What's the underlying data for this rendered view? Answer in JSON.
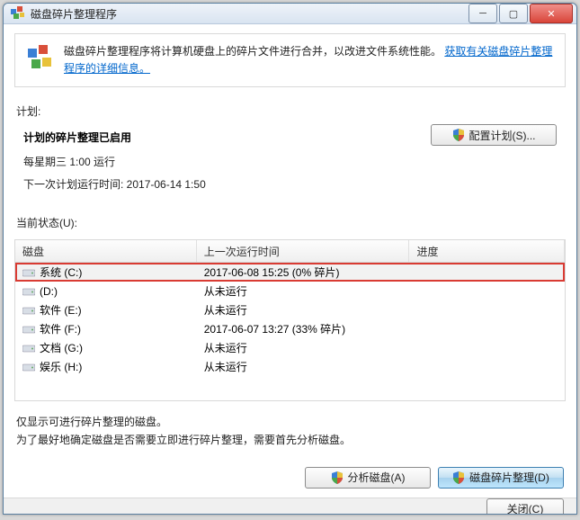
{
  "window": {
    "title": "磁盘碎片整理程序"
  },
  "info": {
    "text_prefix": "磁盘碎片整理程序将计算机硬盘上的碎片文件进行合并，以改进文件系统性能。",
    "link_text": "获取有关磁盘碎片整理程序的详细信息。"
  },
  "schedule": {
    "section_label": "计划:",
    "heading": "计划的碎片整理已启用",
    "frequency": "每星期三  1:00 运行",
    "next_run": "下一次计划运行时间: 2017-06-14 1:50",
    "configure_btn": "配置计划(S)..."
  },
  "status": {
    "section_label": "当前状态(U):",
    "columns": {
      "disk": "磁盘",
      "last_run": "上一次运行时间",
      "progress": "进度"
    },
    "rows": [
      {
        "name": "系统 (C:)",
        "last_run": "2017-06-08 15:25 (0% 碎片)",
        "progress": "",
        "selected": true
      },
      {
        "name": "(D:)",
        "last_run": "从未运行",
        "progress": "",
        "selected": false
      },
      {
        "name": "软件 (E:)",
        "last_run": "从未运行",
        "progress": "",
        "selected": false
      },
      {
        "name": "软件 (F:)",
        "last_run": "2017-06-07 13:27 (33% 碎片)",
        "progress": "",
        "selected": false
      },
      {
        "name": "文档 (G:)",
        "last_run": "从未运行",
        "progress": "",
        "selected": false
      },
      {
        "name": "娱乐 (H:)",
        "last_run": "从未运行",
        "progress": "",
        "selected": false
      }
    ]
  },
  "hint": {
    "line1": "仅显示可进行碎片整理的磁盘。",
    "line2": "为了最好地确定磁盘是否需要立即进行碎片整理，需要首先分析磁盘。"
  },
  "buttons": {
    "analyze": "分析磁盘(A)",
    "defrag": "磁盘碎片整理(D)",
    "close": "关闭(C)"
  }
}
